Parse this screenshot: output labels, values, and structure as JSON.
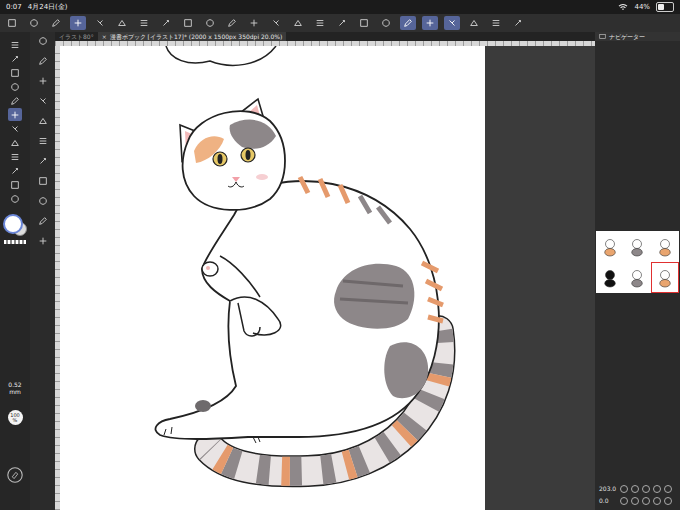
{
  "status_bar": {
    "time": "0:07",
    "date": "4月24日(金)",
    "battery": "44%",
    "battery_level": 0.44
  },
  "toolbar": [
    {
      "selected": false
    },
    {
      "selected": false
    },
    {
      "selected": false
    },
    {
      "selected": true
    },
    {
      "selected": false
    },
    {
      "selected": false
    },
    {
      "selected": false
    },
    {
      "selected": false
    },
    {
      "selected": false
    },
    {
      "selected": false
    },
    {
      "selected": false
    },
    {
      "selected": false
    },
    {
      "selected": false
    },
    {
      "selected": false
    },
    {
      "selected": false
    },
    {
      "selected": false
    },
    {
      "selected": false
    },
    {
      "selected": false
    },
    {
      "selected": true
    },
    {
      "selected": true
    },
    {
      "selected": true
    },
    {
      "selected": false
    },
    {
      "selected": false
    },
    {
      "selected": false
    }
  ],
  "tabs": [
    {
      "label": "イラスト80°",
      "selected": false,
      "close": ""
    },
    {
      "label": "漫書ポブック [イラスト17]* (2000 x 1500px 350dpi 20.0%)",
      "selected": true,
      "close": "×"
    }
  ],
  "tools": [
    {
      "selected": false
    },
    {
      "selected": false
    },
    {
      "selected": false
    },
    {
      "selected": false
    },
    {
      "selected": false
    },
    {
      "selected": true
    },
    {
      "selected": false
    },
    {
      "selected": false
    },
    {
      "selected": false
    },
    {
      "selected": false
    },
    {
      "selected": false
    },
    {
      "selected": false
    }
  ],
  "sub_tools": [
    {
      "selected": false
    },
    {
      "selected": false
    },
    {
      "selected": false
    },
    {
      "selected": false
    },
    {
      "selected": false
    },
    {
      "selected": false
    },
    {
      "selected": false
    },
    {
      "selected": false
    },
    {
      "selected": false
    },
    {
      "selected": false
    },
    {
      "selected": false
    }
  ],
  "main_color": "#ffffff",
  "brush": {
    "size": "0.52",
    "unit": "mm",
    "opacity": "100",
    "opacity_unit": "%"
  },
  "panel": {
    "title": "ナビゲーター"
  },
  "navigator": {
    "zoom": "203.0",
    "rotation": "0.0",
    "thumbnails": [
      {
        "selected": false
      },
      {
        "selected": false
      },
      {
        "selected": false
      },
      {
        "selected": false
      },
      {
        "selected": false
      },
      {
        "selected": true
      }
    ]
  }
}
